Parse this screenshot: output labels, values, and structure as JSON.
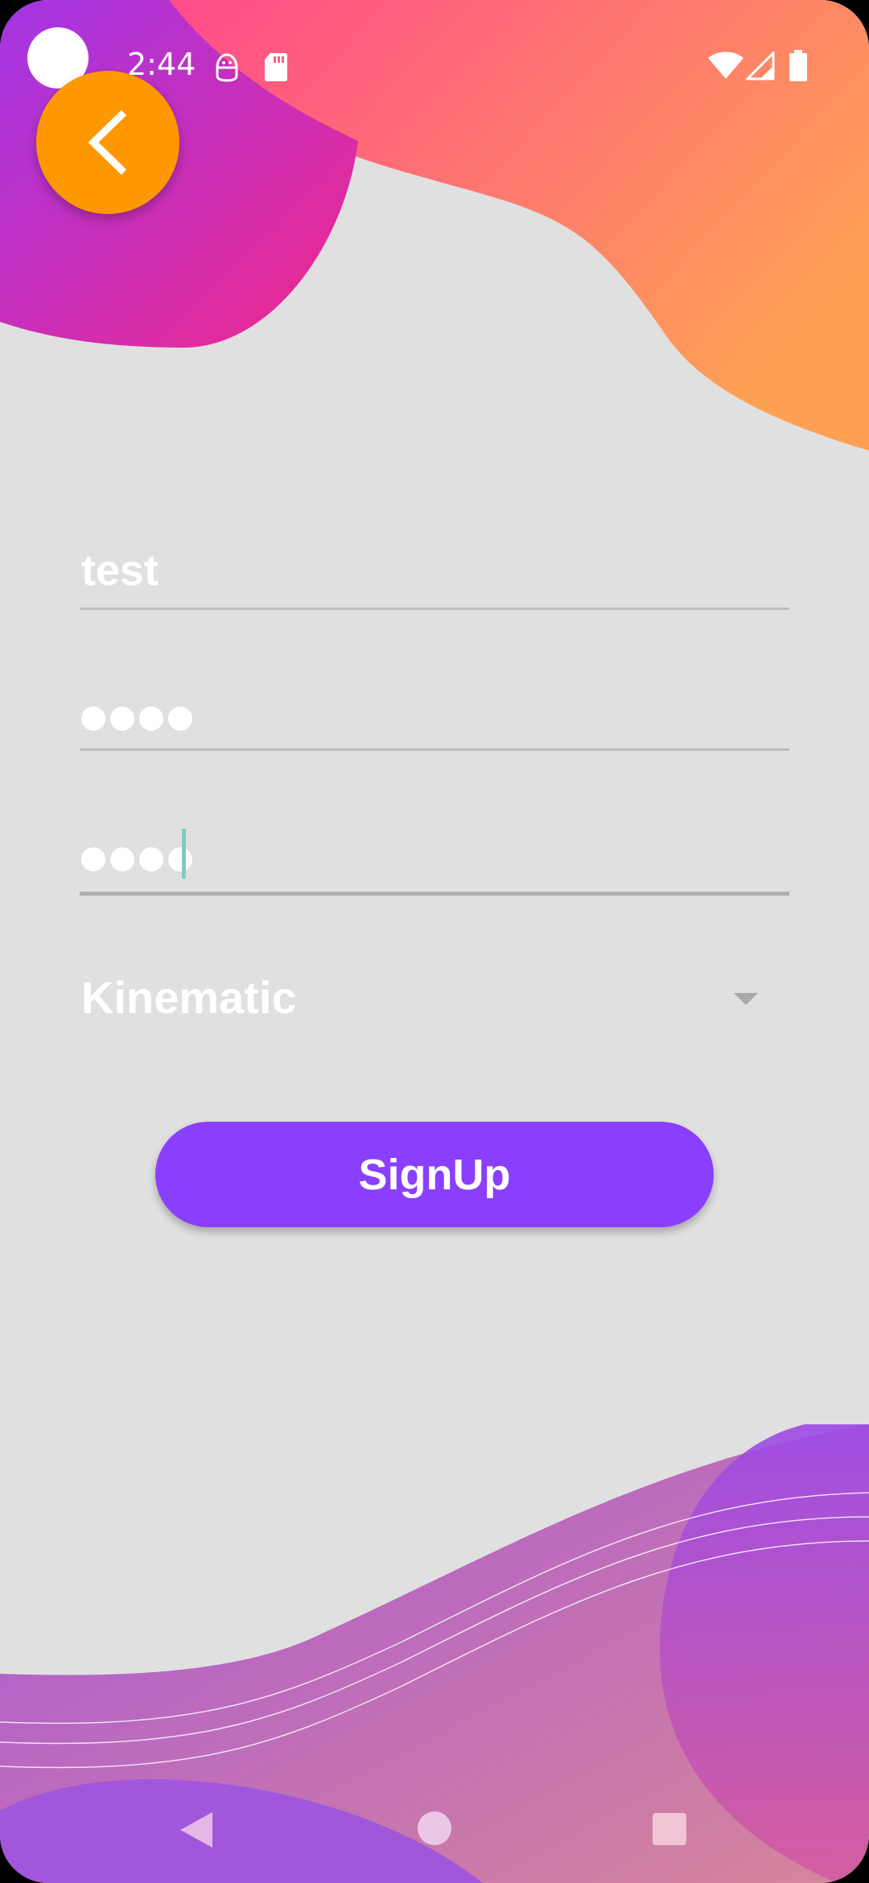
{
  "status_bar": {
    "time": "2:44",
    "left_icons": [
      "android-debug-icon",
      "sd-card-icon"
    ],
    "right_icons": [
      "wifi-icon",
      "signal-icon",
      "battery-icon"
    ]
  },
  "back_button": {
    "icon": "chevron-left-icon",
    "color": "#ff9800"
  },
  "form": {
    "username_value": "test",
    "password_masked_length": 4,
    "confirm_password_masked_length": 4,
    "role_selected": "Kinematic",
    "submit_label": "SignUp"
  },
  "colors": {
    "background": "#e0e0e0",
    "button": "#8a3ffc",
    "top_gradient_start": "#ff4b8b",
    "top_gradient_end": "#ffa155",
    "bottom_gradient": "#a050e0"
  },
  "nav_bar": {
    "buttons": [
      "back-icon",
      "home-icon",
      "recents-icon"
    ]
  }
}
